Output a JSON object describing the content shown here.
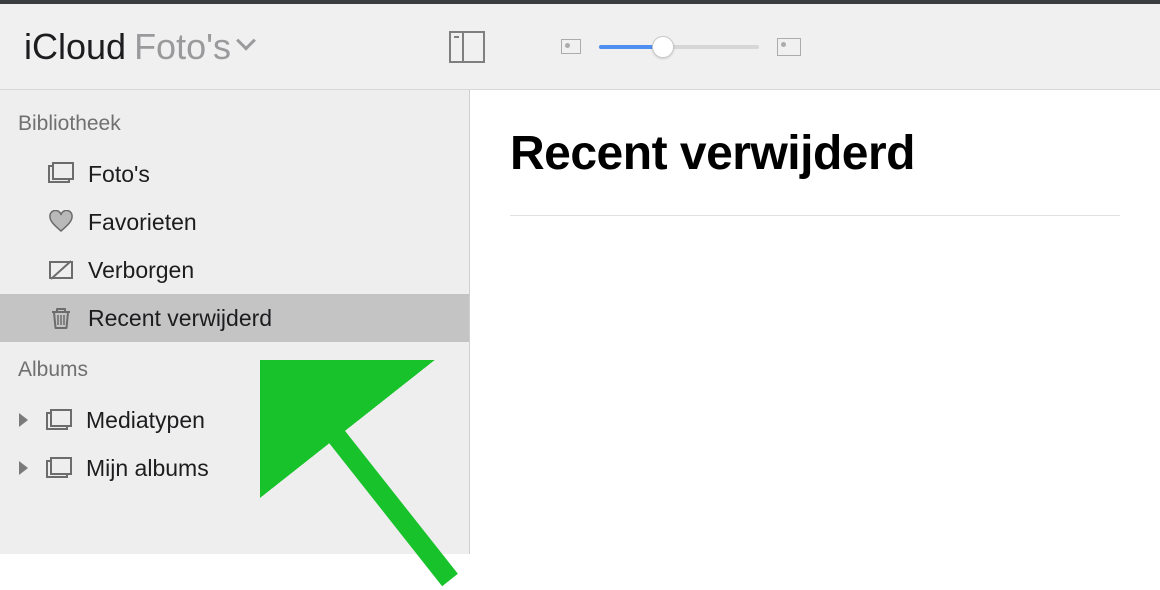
{
  "toolbar": {
    "app": "iCloud",
    "album": "Foto's"
  },
  "sidebar": {
    "sections": [
      {
        "header": "Bibliotheek",
        "items": [
          {
            "icon": "photos",
            "label": "Foto's",
            "selected": false
          },
          {
            "icon": "heart",
            "label": "Favorieten",
            "selected": false
          },
          {
            "icon": "hidden",
            "label": "Verborgen",
            "selected": false
          },
          {
            "icon": "trash",
            "label": "Recent verwijderd",
            "selected": true
          }
        ]
      },
      {
        "header": "Albums",
        "items": [
          {
            "icon": "album",
            "label": "Mediatypen",
            "caret": true
          },
          {
            "icon": "album",
            "label": "Mijn albums",
            "caret": true
          }
        ]
      }
    ]
  },
  "content": {
    "heading": "Recent verwijderd"
  }
}
